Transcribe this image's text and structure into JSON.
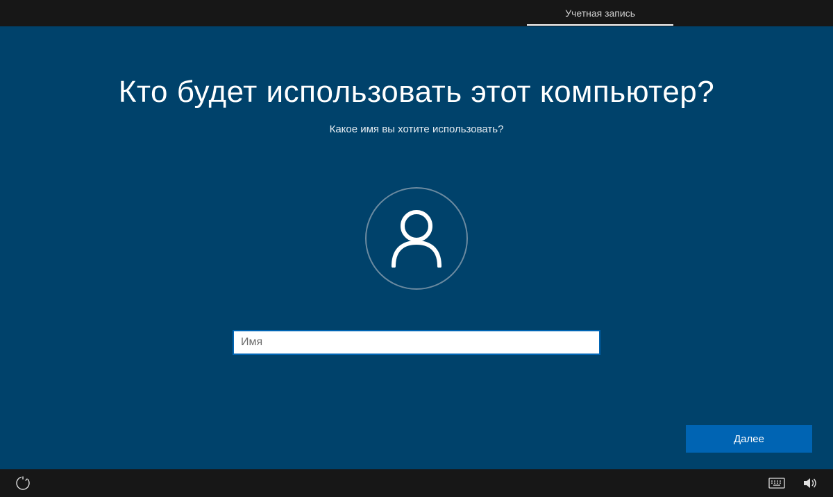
{
  "topbar": {
    "tab_label": "Учетная запись"
  },
  "main": {
    "title": "Кто будет использовать этот компьютер?",
    "subtitle": "Какое имя вы хотите использовать?",
    "name_placeholder": "Имя",
    "name_value": "",
    "next_label": "Далее"
  },
  "icons": {
    "avatar": "user-icon",
    "ease_of_access": "accessibility-icon",
    "keyboard": "keyboard-icon",
    "volume": "volume-icon"
  }
}
